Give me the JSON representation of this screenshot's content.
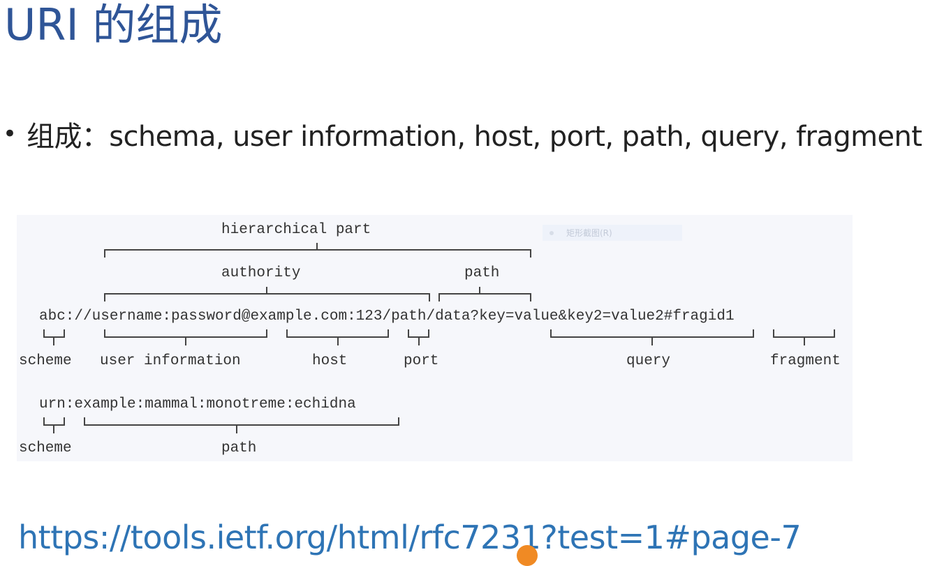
{
  "slide": {
    "title": "URI 的组成",
    "bullet": "组成：schema, user information, host, port, path, query, fragment",
    "link": "https://tools.ietf.org/html/rfc7231?test=1#page-7"
  },
  "diagram": {
    "example1": "abc://username:password@example.com:123/path/data?key=value&key2=value2#fragid1",
    "example2": "urn:example:mammal:monotreme:echidna",
    "labels": {
      "hierarchical_part": "hierarchical part",
      "authority": "authority",
      "path_top": "path",
      "scheme": "scheme",
      "user_information": "user information",
      "host": "host",
      "port": "port",
      "query": "query",
      "fragment": "fragment",
      "scheme2": "scheme",
      "path2": "path"
    }
  },
  "overlay": {
    "tooltip": "矩形截图(R)"
  },
  "colors": {
    "title": "#2f5597",
    "link": "#2e74b5",
    "panel_bg": "#f6f7fb",
    "cursor": "#f08a24"
  }
}
